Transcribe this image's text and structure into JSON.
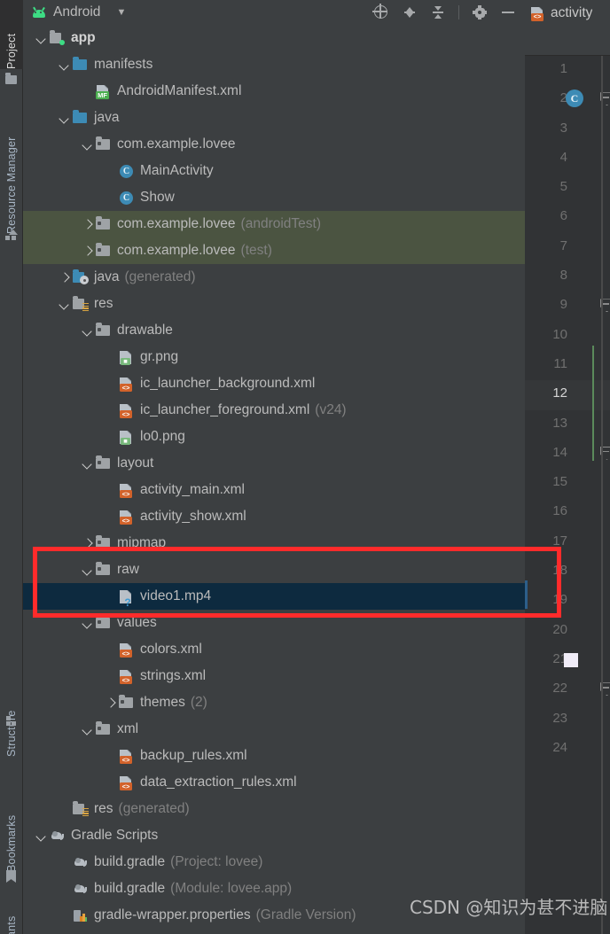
{
  "tool_strip": {
    "tabs": [
      {
        "label": "Project",
        "icon": "folder-icon",
        "active": true
      },
      {
        "label": "Resource Manager",
        "icon": "resource-manager-icon",
        "active": false
      },
      {
        "label": "Structure",
        "icon": "structure-icon",
        "active": false
      },
      {
        "label": "Bookmarks",
        "icon": "bookmark-icon",
        "active": false
      },
      {
        "label": "ants",
        "icon": "",
        "active": false
      }
    ]
  },
  "panel": {
    "title": "Android",
    "caret": "▼",
    "toolbar": [
      {
        "name": "select-opened-file-icon",
        "title": "Select Opened File"
      },
      {
        "name": "expand-all-icon",
        "title": "Expand All"
      },
      {
        "name": "collapse-all-icon",
        "title": "Collapse All"
      },
      {
        "name": "settings-gear-icon",
        "title": "Settings"
      },
      {
        "name": "hide-icon",
        "title": "Hide"
      }
    ]
  },
  "tree": [
    {
      "indent": 0,
      "arrow": "down",
      "icon": "module-folder",
      "label": "app",
      "suffix": "",
      "style": "bold",
      "state": "normal"
    },
    {
      "indent": 1,
      "arrow": "down",
      "icon": "folder-blue",
      "label": "manifests",
      "suffix": "",
      "style": "",
      "state": "normal"
    },
    {
      "indent": 2,
      "arrow": "none",
      "icon": "file-mf",
      "label": "AndroidManifest.xml",
      "suffix": "",
      "style": "",
      "state": "normal"
    },
    {
      "indent": 1,
      "arrow": "down",
      "icon": "folder-blue",
      "label": "java",
      "suffix": "",
      "style": "",
      "state": "normal"
    },
    {
      "indent": 2,
      "arrow": "down",
      "icon": "folder-gray",
      "label": "com.example.lovee",
      "suffix": "",
      "style": "",
      "state": "normal"
    },
    {
      "indent": 3,
      "arrow": "none",
      "icon": "class-c",
      "label": "MainActivity",
      "suffix": "",
      "style": "",
      "state": "normal"
    },
    {
      "indent": 3,
      "arrow": "none",
      "icon": "class-c",
      "label": "Show",
      "suffix": "",
      "style": "",
      "state": "normal"
    },
    {
      "indent": 2,
      "arrow": "right",
      "icon": "folder-gray",
      "label": "com.example.lovee",
      "suffix": "(androidTest)",
      "style": "",
      "state": "green"
    },
    {
      "indent": 2,
      "arrow": "right",
      "icon": "folder-gray",
      "label": "com.example.lovee",
      "suffix": "(test)",
      "style": "",
      "state": "green"
    },
    {
      "indent": 1,
      "arrow": "right",
      "icon": "folder-generated",
      "label": "java",
      "suffix": "(generated)",
      "style": "",
      "state": "normal"
    },
    {
      "indent": 1,
      "arrow": "down",
      "icon": "folder-res",
      "label": "res",
      "suffix": "",
      "style": "",
      "state": "normal"
    },
    {
      "indent": 2,
      "arrow": "down",
      "icon": "folder-gray",
      "label": "drawable",
      "suffix": "",
      "style": "",
      "state": "normal"
    },
    {
      "indent": 3,
      "arrow": "none",
      "icon": "file-img",
      "label": "gr.png",
      "suffix": "",
      "style": "",
      "state": "normal"
    },
    {
      "indent": 3,
      "arrow": "none",
      "icon": "file-xml",
      "label": "ic_launcher_background.xml",
      "suffix": "",
      "style": "",
      "state": "normal"
    },
    {
      "indent": 3,
      "arrow": "none",
      "icon": "file-xml",
      "label": "ic_launcher_foreground.xml",
      "suffix": "(v24)",
      "style": "",
      "state": "normal"
    },
    {
      "indent": 3,
      "arrow": "none",
      "icon": "file-img",
      "label": "lo0.png",
      "suffix": "",
      "style": "",
      "state": "normal"
    },
    {
      "indent": 2,
      "arrow": "down",
      "icon": "folder-gray",
      "label": "layout",
      "suffix": "",
      "style": "",
      "state": "normal"
    },
    {
      "indent": 3,
      "arrow": "none",
      "icon": "file-xml",
      "label": "activity_main.xml",
      "suffix": "",
      "style": "",
      "state": "normal"
    },
    {
      "indent": 3,
      "arrow": "none",
      "icon": "file-xml",
      "label": "activity_show.xml",
      "suffix": "",
      "style": "",
      "state": "normal"
    },
    {
      "indent": 2,
      "arrow": "right",
      "icon": "folder-gray",
      "label": "mipmap",
      "suffix": "",
      "style": "",
      "state": "normal"
    },
    {
      "indent": 2,
      "arrow": "down",
      "icon": "folder-gray",
      "label": "raw",
      "suffix": "",
      "style": "",
      "state": "normal"
    },
    {
      "indent": 3,
      "arrow": "none",
      "icon": "file-unknown",
      "label": "video1.mp4",
      "suffix": "",
      "style": "",
      "state": "selected"
    },
    {
      "indent": 2,
      "arrow": "down",
      "icon": "folder-gray",
      "label": "values",
      "suffix": "",
      "style": "",
      "state": "normal"
    },
    {
      "indent": 3,
      "arrow": "none",
      "icon": "file-xml",
      "label": "colors.xml",
      "suffix": "",
      "style": "",
      "state": "normal"
    },
    {
      "indent": 3,
      "arrow": "none",
      "icon": "file-xml",
      "label": "strings.xml",
      "suffix": "",
      "style": "",
      "state": "normal"
    },
    {
      "indent": 3,
      "arrow": "right",
      "icon": "folder-gray",
      "label": "themes",
      "suffix": "(2)",
      "style": "",
      "state": "normal"
    },
    {
      "indent": 2,
      "arrow": "down",
      "icon": "folder-gray",
      "label": "xml",
      "suffix": "",
      "style": "",
      "state": "normal"
    },
    {
      "indent": 3,
      "arrow": "none",
      "icon": "file-xml",
      "label": "backup_rules.xml",
      "suffix": "",
      "style": "",
      "state": "normal"
    },
    {
      "indent": 3,
      "arrow": "none",
      "icon": "file-xml",
      "label": "data_extraction_rules.xml",
      "suffix": "",
      "style": "",
      "state": "normal"
    },
    {
      "indent": 1,
      "arrow": "none",
      "icon": "folder-res",
      "label": "res",
      "suffix": "(generated)",
      "style": "",
      "state": "normal"
    },
    {
      "indent": 0,
      "arrow": "down",
      "icon": "gradle",
      "label": "Gradle Scripts",
      "suffix": "",
      "style": "",
      "state": "normal"
    },
    {
      "indent": 1,
      "arrow": "none",
      "icon": "gradle",
      "label": "build.gradle",
      "suffix": "(Project: lovee)",
      "style": "",
      "state": "normal"
    },
    {
      "indent": 1,
      "arrow": "none",
      "icon": "gradle",
      "label": "build.gradle",
      "suffix": "(Module: lovee.app)",
      "style": "",
      "state": "normal"
    },
    {
      "indent": 1,
      "arrow": "none",
      "icon": "properties",
      "label": "gradle-wrapper.properties",
      "suffix": "(Gradle Version)",
      "style": "",
      "state": "normal"
    }
  ],
  "editor": {
    "tab_label": "activity",
    "tab_icon": "file-xml",
    "line_numbers": [
      "1",
      "2",
      "3",
      "4",
      "5",
      "6",
      "7",
      "8",
      "9",
      "10",
      "11",
      "12",
      "13",
      "14",
      "15",
      "16",
      "17",
      "18",
      "19",
      "20",
      "21",
      "22",
      "23",
      "24"
    ],
    "current_line": "12",
    "class_marker_line": "2",
    "class_marker_label": "C",
    "white_marker_line": "21",
    "fold_marker_lines": [
      "2",
      "9",
      "14",
      "22"
    ]
  },
  "annotation": {
    "box_color": "#ff2b2b"
  },
  "watermark": {
    "text": "CSDN @知识为甚不进脑"
  }
}
